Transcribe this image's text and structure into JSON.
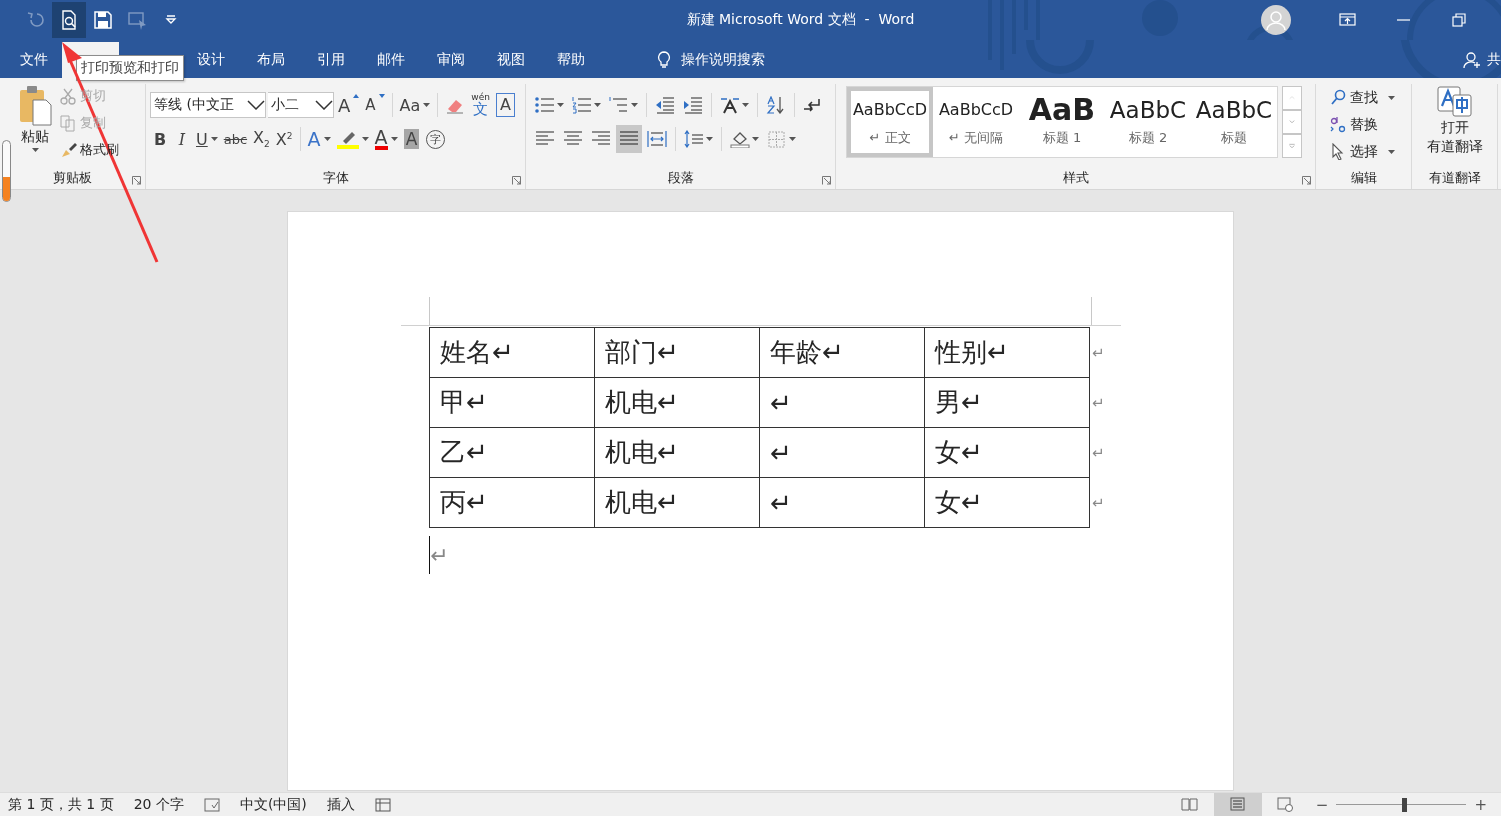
{
  "window": {
    "title": "新建 Microsoft Word 文档  -  Word"
  },
  "quick_access": [
    {
      "kind": "undo",
      "disabled": true,
      "selected": false
    },
    {
      "kind": "preview",
      "disabled": false,
      "selected": true
    },
    {
      "kind": "save",
      "disabled": false,
      "selected": false
    },
    {
      "kind": "touch",
      "disabled": true,
      "selected": false
    },
    {
      "kind": "customize",
      "disabled": false,
      "selected": false
    }
  ],
  "tabs": [
    {
      "label": "文件",
      "selected": false
    },
    {
      "selected": true
    },
    {
      "label": "设计",
      "selected": false
    },
    {
      "label": "布局",
      "selected": false
    },
    {
      "label": "引用",
      "selected": false
    },
    {
      "label": "邮件",
      "selected": false
    },
    {
      "label": "审阅",
      "selected": false
    },
    {
      "label": "视图",
      "selected": false
    },
    {
      "label": "帮助",
      "selected": false
    }
  ],
  "tell_me": {
    "label": "操作说明搜索"
  },
  "share": {
    "label": "共"
  },
  "tooltip": {
    "text": "打印预览和打印"
  },
  "ribbon": {
    "clipboard": {
      "title": "剪贴板",
      "paste": "粘贴",
      "items": [
        {
          "label": "剪切",
          "kind": "cut",
          "disabled": true
        },
        {
          "label": "复制",
          "kind": "copy",
          "disabled": true
        },
        {
          "label": "格式刷",
          "kind": "brush",
          "disabled": false
        }
      ]
    },
    "font": {
      "title": "字体",
      "font_name": "等线 (中文正",
      "font_size": "小二",
      "row1": [
        {
          "kind": "grow",
          "label": "A"
        },
        {
          "kind": "shrink",
          "label": "A"
        },
        {
          "kind": "case",
          "label": "Aa",
          "dropdown": true
        },
        {
          "kind": "clear"
        },
        {
          "kind": "phonetic",
          "label": "wén",
          "base": "文"
        },
        {
          "kind": "border",
          "label": "A"
        }
      ],
      "row2": [
        {
          "kind": "bold",
          "label": "B"
        },
        {
          "kind": "italic",
          "label": "I"
        },
        {
          "kind": "underline",
          "label": "U",
          "dropdown": true
        },
        {
          "kind": "strike",
          "label": "abc"
        },
        {
          "kind": "plain",
          "label": "X$_{2}$"
        },
        {
          "kind": "plain",
          "label": "X$^{2}$"
        },
        {
          "kind": "effect",
          "label": "A",
          "dropdown": true
        },
        {
          "kind": "highlight",
          "dropdown": true
        },
        {
          "kind": "color",
          "label": "A",
          "dropdown": true
        },
        {
          "kind": "shade",
          "label": "A"
        },
        {
          "kind": "enclose",
          "label": "字"
        }
      ]
    },
    "paragraph": {
      "title": "段落",
      "alignment": [
        {
          "selected": false
        },
        {
          "selected": false
        },
        {
          "selected": false
        },
        {
          "selected": true
        },
        {
          "selected": false
        }
      ]
    },
    "styles": {
      "title": "样式",
      "items": [
        {
          "kind": "normal",
          "preview": "AaBbCcD",
          "mark": "↵",
          "name": "正文",
          "selected": true
        },
        {
          "kind": "normal",
          "preview": "AaBbCcD",
          "mark": "↵",
          "name": "无间隔",
          "selected": false
        },
        {
          "kind": "heading1",
          "preview": "AaB",
          "name": "标题 1",
          "selected": false
        },
        {
          "kind": "heading2",
          "preview": "AaBbC",
          "name": "标题 2",
          "selected": false
        },
        {
          "kind": "title",
          "preview": "AaBbC",
          "name": "标题",
          "selected": false
        }
      ]
    },
    "editing": {
      "title": "编辑",
      "items": [
        {
          "kind": "find",
          "label": "查找",
          "dropdown": true
        },
        {
          "kind": "replace",
          "label": "替换",
          "dropdown": false
        },
        {
          "kind": "select",
          "label": "选择",
          "dropdown": true
        }
      ]
    },
    "youdao": {
      "title": "有道翻译",
      "label_lines": [
        "打开",
        "有道翻译"
      ]
    }
  },
  "document": {
    "table": {
      "rows": [
        {
          "cells": [
            "姓名↵",
            "部门↵",
            "年龄↵",
            "性别↵"
          ],
          "end_mark": "↵"
        },
        {
          "cells": [
            "甲↵",
            "机电↵",
            "↵",
            "男↵"
          ],
          "end_mark": "↵"
        },
        {
          "cells": [
            "乙↵",
            "机电↵",
            "↵",
            "女↵"
          ],
          "end_mark": "↵"
        },
        {
          "cells": [
            "丙↵",
            "机电↵",
            "↵",
            "女↵"
          ],
          "end_mark": "↵"
        }
      ]
    },
    "after_table": "↵"
  },
  "status_bar": {
    "page": "第 1 页，共 1 页",
    "words": "20 个字",
    "language": "中文(中国)",
    "mode": "插入",
    "views": [
      {
        "kind": "read",
        "selected": false
      },
      {
        "kind": "print",
        "selected": true
      },
      {
        "kind": "web",
        "selected": false
      }
    ],
    "zoom": {
      "minus": "−",
      "plus": "+",
      "level": 0.52
    }
  }
}
